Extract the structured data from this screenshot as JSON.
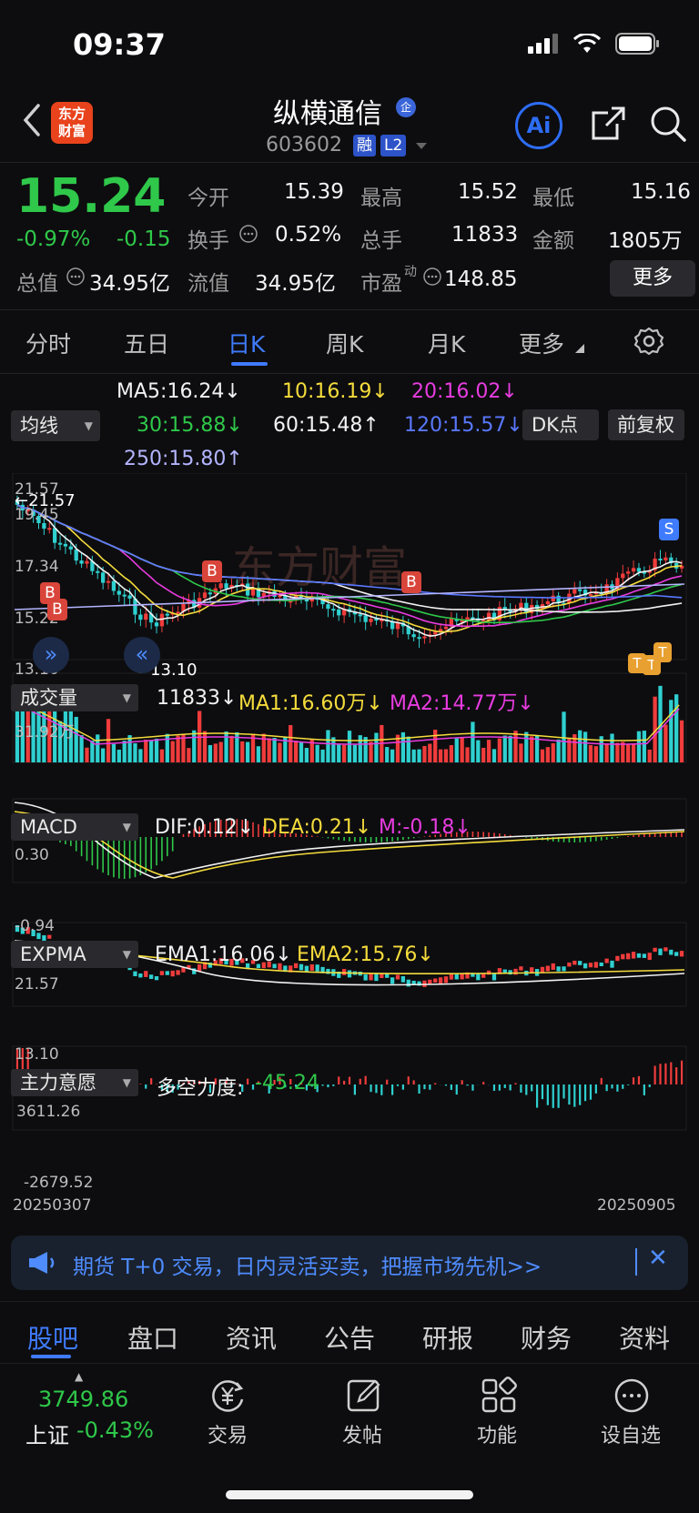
{
  "status_bar": {
    "time": "09:37"
  },
  "header": {
    "logo_text_1": "东方",
    "logo_text_2": "财富",
    "stock_name": "纵横通信",
    "name_badge": "企",
    "stock_code": "603602",
    "tag_margin": "融",
    "tag_level": "L2",
    "ai_label": "Ai"
  },
  "quote": {
    "price": "15.24",
    "change_pct": "-0.97%",
    "change": "-0.15",
    "open_label": "今开",
    "open": "15.39",
    "high_label": "最高",
    "high": "15.52",
    "low_label": "最低",
    "low": "15.16",
    "turnover_label": "换手",
    "turnover": "0.52%",
    "volume_label": "总手",
    "volume": "11833",
    "amount_label": "金额",
    "amount": "1805万",
    "mktcap_label": "总值",
    "mktcap": "34.95亿",
    "float_label": "流值",
    "float_cap": "34.95亿",
    "pe_label": "市盈",
    "pe_sup": "动",
    "pe": "148.85",
    "more": "更多"
  },
  "period_tabs": [
    "分时",
    "五日",
    "日K",
    "周K",
    "月K",
    "更多"
  ],
  "active_period": 2,
  "ma_legend": {
    "selector": "均线",
    "ma5": "MA5:16.24↓",
    "ma10": "10:16.19↓",
    "ma20": "20:16.02↓",
    "ma30": "30:15.88↓",
    "ma60": "60:15.48↑",
    "ma120": "120:15.57↓",
    "ma250": "250:15.80↑",
    "dk": "DK点",
    "adjust": "前复权"
  },
  "colors": {
    "up": "#f03c3c",
    "down": "#2fd0d0",
    "green": "#2fc84a",
    "ma5": "#f2f2f2",
    "ma10": "#f5dc3c",
    "ma20": "#e83ce0",
    "ma30": "#2fc84a",
    "ma60": "#f2f2f2",
    "ma120": "#5a78ff",
    "ma250": "#b4b4ff",
    "accent": "#3f7bff"
  },
  "main_chart": {
    "y_top": "21.57",
    "y_hi_marker": "21.57",
    "y_2": "19.45",
    "y_3": "17.34",
    "y_4": "15.22",
    "y_bottom": "13.10",
    "low_marker": "13.10",
    "watermark": "东方财富",
    "signal_b": "B",
    "signal_s": "S",
    "signal_t": "T"
  },
  "volume_panel": {
    "selector": "成交量",
    "vol": "11833↓",
    "ma1": "MA1:16.60万↓",
    "ma2": "MA2:14.77万↓",
    "y_top": "31.92万"
  },
  "macd_panel": {
    "selector": "MACD",
    "dif": "DIF:0.12↓",
    "dea": "DEA:0.21↓",
    "m": "M:-0.18↓",
    "y_top": "0.30",
    "y_bottom": "-0.94"
  },
  "expma_panel": {
    "selector": "EXPMA",
    "ema1": "EMA1:16.06↓",
    "ema2": "EMA2:15.76↓",
    "y_top": "21.57",
    "y_bottom": "13.10"
  },
  "main_force_panel": {
    "selector": "主力意愿",
    "label": "多空力度:",
    "value": "-45.24",
    "y_top": "3611.26",
    "y_bottom": "-2679.52"
  },
  "date_axis": {
    "start": "20250307",
    "end": "20250905"
  },
  "banner": {
    "text": "期货 T+0 交易，日内灵活买卖，把握市场先机>>"
  },
  "bottom_tabs": [
    "股吧",
    "盘口",
    "资讯",
    "公告",
    "研报",
    "财务",
    "资料"
  ],
  "bottom_bar": {
    "index_value": "3749.86",
    "index_name": "上证",
    "index_change": "-0.43%",
    "trade": "交易",
    "post": "发帖",
    "functions": "功能",
    "watchlist": "设自选"
  }
}
